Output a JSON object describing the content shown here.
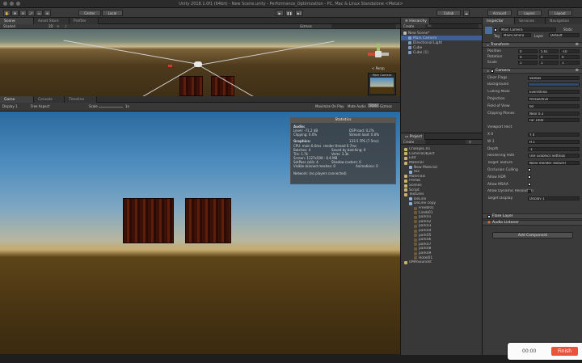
{
  "window": {
    "title": "Unity 2018.1.0f1 (64bit) - New Scene.unity - Performance_Optimization - PC, Mac & Linux Standalone <Metal>"
  },
  "toolbar": {
    "center_label": "Center",
    "local_label": "Local",
    "collab_label": "Collab",
    "account_label": "Account",
    "layers_label": "Layers",
    "layout_label": "Layout"
  },
  "scene_view": {
    "tabs": [
      "Scene",
      "Asset Store",
      "Profiler"
    ],
    "shading": "Shaded",
    "mode_2d": "2D",
    "gizmos": "Gizmos",
    "persp": "< Persp",
    "camera_preview_label": "Main Camera"
  },
  "game_view": {
    "tabs": [
      "Game",
      "Console",
      "Timeline"
    ],
    "display": "Display 1",
    "aspect": "Free Aspect",
    "scale_label": "Scale",
    "scale_value": "1x",
    "maximize": "Maximize On Play",
    "mute": "Mute Audio",
    "stats": "Stats",
    "gizmos": "Gizmos"
  },
  "stats": {
    "title": "Statistics",
    "audio_header": "Audio:",
    "level": "Level: -71.2 dB",
    "clipping": "Clipping: 0.0%",
    "dsp": "DSP load: 0.2%",
    "stream": "Stream load: 0.0%",
    "graphics_header": "Graphics:",
    "fps": "133.5 FPS (7.5ms)",
    "cpu": "CPU: main 6.0ms  render thread 0.7ms",
    "batches": "Batches: 4",
    "saved": "Saved by batching: 0",
    "tris": "Tris: 1.7k",
    "verts": "Verts: 3.3k",
    "screen": "Screen: 1127x509 - 6.6 MB",
    "setpass": "SetPass calls: 4",
    "shadow": "Shadow casters: 0",
    "skinned": "Visible skinned meshes: 0",
    "animations": "Animations: 0",
    "network": "Network: (no players connected)"
  },
  "hierarchy": {
    "tab": "Hierarchy",
    "create": "Create",
    "search_placeholder": "All",
    "items": [
      {
        "label": "New Scene*",
        "indent": 0,
        "selected": false
      },
      {
        "label": "Main Camera",
        "indent": 1,
        "selected": true
      },
      {
        "label": "Directional Light",
        "indent": 1,
        "selected": false
      },
      {
        "label": "Cube",
        "indent": 1,
        "selected": false
      },
      {
        "label": "Cube (1)",
        "indent": 1,
        "selected": false
      }
    ]
  },
  "project": {
    "tab": "Project",
    "create": "Create",
    "items": [
      {
        "label": "ChangeL.01",
        "indent": 0
      },
      {
        "label": "CameraObject",
        "indent": 0
      },
      {
        "label": "Edit",
        "indent": 0
      },
      {
        "label": "Material",
        "indent": 0
      },
      {
        "label": "New Material",
        "indent": 1
      },
      {
        "label": "tex",
        "indent": 1
      },
      {
        "label": "Materials",
        "indent": 0
      },
      {
        "label": "Prefab",
        "indent": 0
      },
      {
        "label": "Scenes",
        "indent": 0
      },
      {
        "label": "Script",
        "indent": 0
      },
      {
        "label": "Textures",
        "indent": 0
      },
      {
        "label": "DeLine",
        "indent": 1
      },
      {
        "label": "DeLine copy",
        "indent": 1
      },
      {
        "label": "Freebl01",
        "indent": 2
      },
      {
        "label": "Lineb01",
        "indent": 2
      },
      {
        "label": "park01",
        "indent": 2
      },
      {
        "label": "park02",
        "indent": 2
      },
      {
        "label": "park03",
        "indent": 2
      },
      {
        "label": "park04",
        "indent": 2
      },
      {
        "label": "park05",
        "indent": 2
      },
      {
        "label": "park06",
        "indent": 2
      },
      {
        "label": "park07",
        "indent": 2
      },
      {
        "label": "park08",
        "indent": 2
      },
      {
        "label": "park09",
        "indent": 2
      },
      {
        "label": "Hotel01",
        "indent": 2
      },
      {
        "label": "UMASoundst",
        "indent": 0
      }
    ]
  },
  "inspector": {
    "tabs": [
      "Inspector",
      "Services",
      "Navigation"
    ],
    "object_name": "Main Camera",
    "static_label": "Static",
    "tag_label": "Tag",
    "tag_value": "MainCamera",
    "layer_label": "Layer",
    "layer_value": "Default",
    "transform": {
      "header": "Transform",
      "position": {
        "label": "Position",
        "x": "0",
        "y": "5.61",
        "z": "-10"
      },
      "rotation": {
        "label": "Rotation",
        "x": "0",
        "y": "0",
        "z": "0"
      },
      "scale": {
        "label": "Scale",
        "x": "1",
        "y": "1",
        "z": "1"
      }
    },
    "camera": {
      "header": "Camera",
      "rows": [
        {
          "label": "Clear Flags",
          "value": "Skybox"
        },
        {
          "label": "Background",
          "value": ""
        },
        {
          "label": "Culling Mask",
          "value": "Everything"
        },
        {
          "label": "Projection",
          "value": "Perspective"
        },
        {
          "label": "Field of View",
          "value": "60"
        },
        {
          "label": "Clipping Planes",
          "value": "Near  0.3"
        },
        {
          "label": "",
          "value": "Far   1000"
        },
        {
          "label": "Viewport Rect",
          "value": ""
        },
        {
          "label": "X 0",
          "value": "Y 0"
        },
        {
          "label": "W 1",
          "value": "H 1"
        },
        {
          "label": "Depth",
          "value": "-1"
        },
        {
          "label": "Rendering Path",
          "value": "Use Graphics Settings"
        },
        {
          "label": "Target Texture",
          "value": "None (Render Texture)"
        },
        {
          "label": "Occlusion Culling",
          "value": "check"
        },
        {
          "label": "Allow HDR",
          "value": "check"
        },
        {
          "label": "Allow MSAA",
          "value": "check"
        },
        {
          "label": "Allow Dynamic Resolution",
          "value": "empty"
        },
        {
          "label": "Target Display",
          "value": "Display 1"
        }
      ]
    },
    "flare_layer": "Flare Layer",
    "audio_listener": "Audio Listener",
    "add_component": "Add Component"
  },
  "recorder": {
    "time": "00:00",
    "finish_label": "Finish"
  },
  "colors": {
    "selection": "#3e5f96",
    "finish_button": "#e8543c"
  }
}
